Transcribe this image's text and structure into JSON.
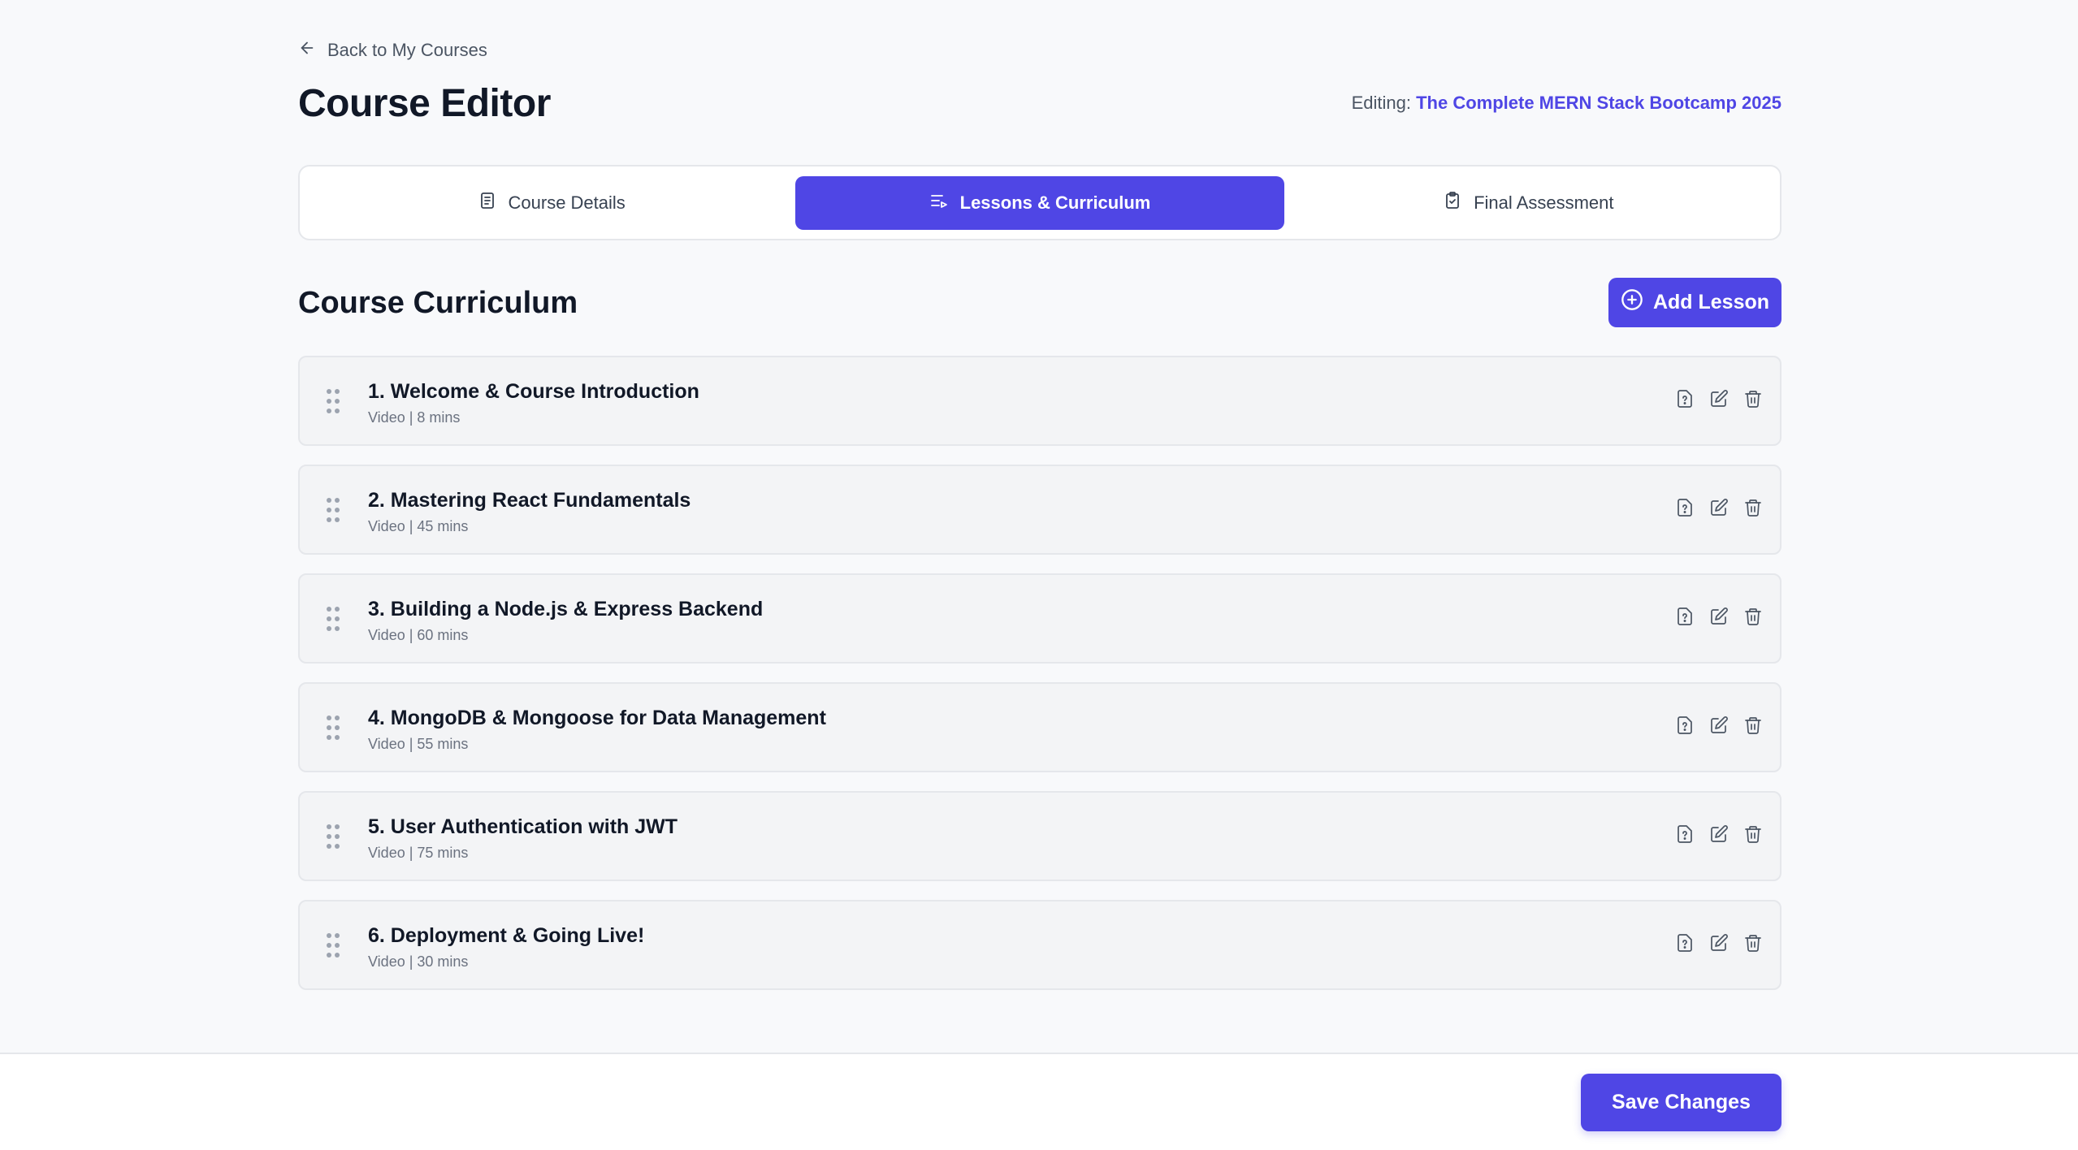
{
  "header": {
    "back_label": "Back to My Courses",
    "title": "Course Editor",
    "editing_prefix": "Editing:",
    "course_name": "The Complete MERN Stack Bootcamp 2025"
  },
  "tabs": [
    {
      "label": "Course Details",
      "icon": "document-icon",
      "active": false
    },
    {
      "label": "Lessons & Curriculum",
      "icon": "list-play-icon",
      "active": true
    },
    {
      "label": "Final Assessment",
      "icon": "clipboard-check-icon",
      "active": false
    }
  ],
  "curriculum": {
    "title": "Course Curriculum",
    "add_label": "Add Lesson",
    "lessons": [
      {
        "title": "1. Welcome & Course Introduction",
        "meta": "Video | 8 mins"
      },
      {
        "title": "2. Mastering React Fundamentals",
        "meta": "Video | 45 mins"
      },
      {
        "title": "3. Building a Node.js & Express Backend",
        "meta": "Video | 60 mins"
      },
      {
        "title": "4. MongoDB & Mongoose for Data Management",
        "meta": "Video | 55 mins"
      },
      {
        "title": "5. User Authentication with JWT",
        "meta": "Video | 75 mins"
      },
      {
        "title": "6. Deployment & Going Live!",
        "meta": "Video | 30 mins"
      }
    ]
  },
  "footer": {
    "save_label": "Save Changes"
  },
  "colors": {
    "accent": "#4f46e5",
    "background": "#f8f9fb",
    "card": "#f3f4f6"
  }
}
